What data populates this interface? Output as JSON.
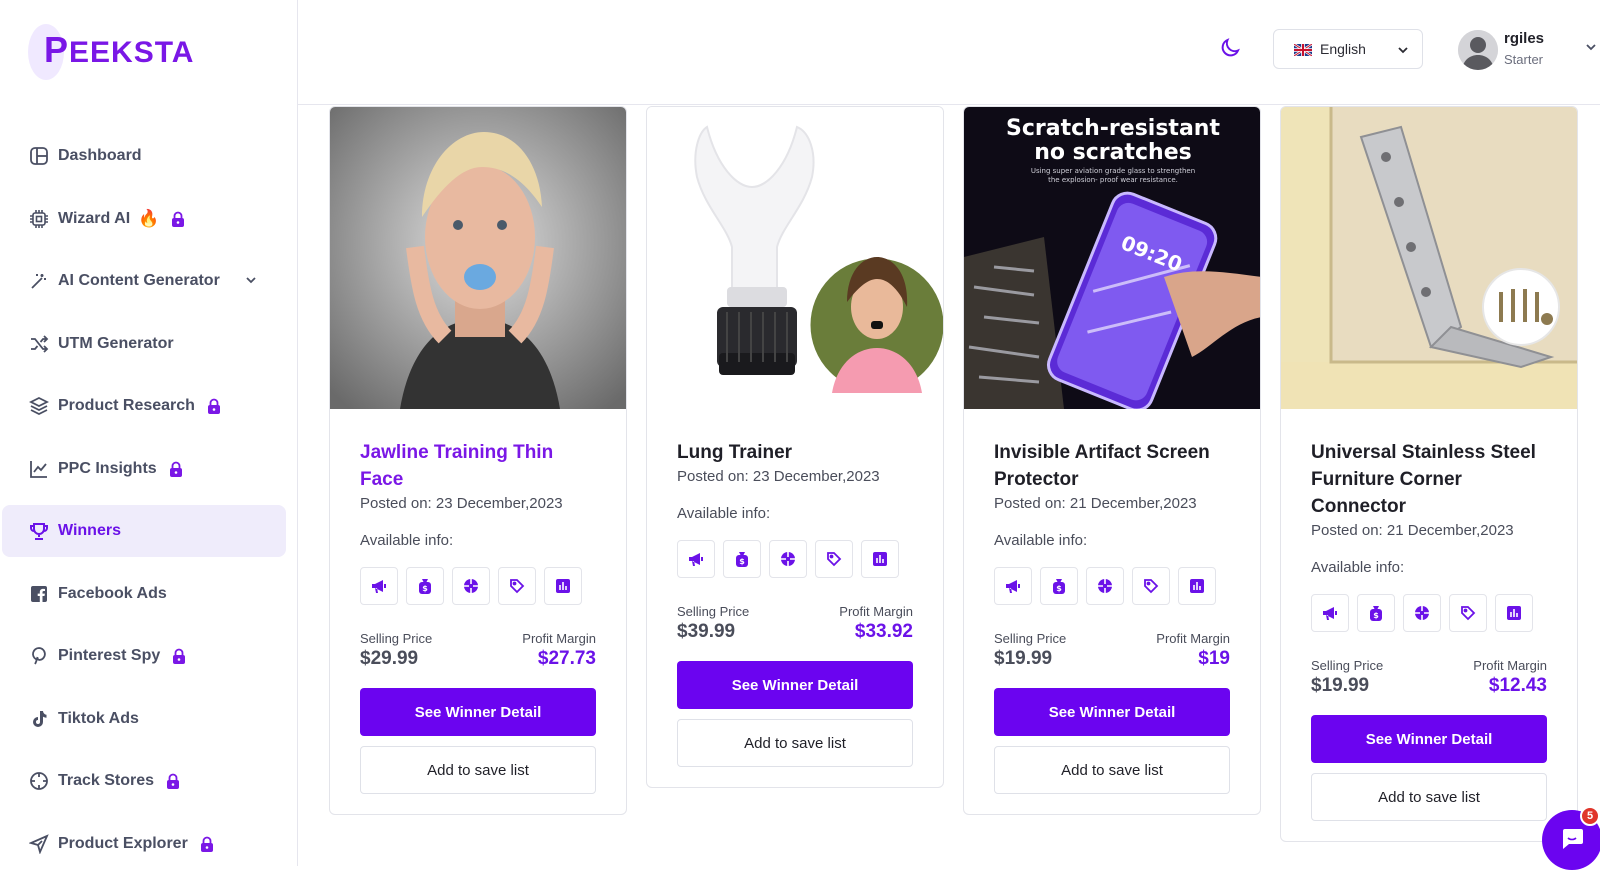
{
  "brand": {
    "logo_first": "P",
    "logo_rest": "EEKSTA"
  },
  "sidebar": {
    "items": [
      {
        "label": "Dashboard",
        "icon": "dashboard-icon",
        "locked": false
      },
      {
        "label": "Wizard AI",
        "icon": "chip-icon",
        "locked": true,
        "emoji": "🔥"
      },
      {
        "label": "AI Content Generator",
        "icon": "magic-wand-icon",
        "locked": false,
        "expandable": true
      },
      {
        "label": "UTM Generator",
        "icon": "shuffle-icon",
        "locked": false
      },
      {
        "label": "Product Research",
        "icon": "layers-icon",
        "locked": true
      },
      {
        "label": "PPC Insights",
        "icon": "line-chart-icon",
        "locked": true
      },
      {
        "label": "Winners",
        "icon": "trophy-icon",
        "locked": false,
        "active": true
      },
      {
        "label": "Facebook Ads",
        "icon": "facebook-icon",
        "locked": false
      },
      {
        "label": "Pinterest Spy",
        "icon": "pinterest-icon",
        "locked": true
      },
      {
        "label": "Tiktok Ads",
        "icon": "tiktok-icon",
        "locked": false
      },
      {
        "label": "Track Stores",
        "icon": "crosshair-icon",
        "locked": true
      },
      {
        "label": "Product Explorer",
        "icon": "send-icon",
        "locked": true
      }
    ]
  },
  "header": {
    "language": "English",
    "user": {
      "name": "rgiles",
      "plan": "Starter"
    }
  },
  "cards": [
    {
      "title": "Jawline Training Thin Face",
      "posted": "Posted on: 23 December,2023",
      "available_label": "Available info:",
      "selling_label": "Selling Price",
      "selling": "$29.99",
      "profit_label": "Profit Margin",
      "profit": "$27.73",
      "detail_label": "See Winner Detail",
      "save_label": "Add to save list"
    },
    {
      "title": "Lung Trainer",
      "posted": "Posted on: 23 December,2023",
      "available_label": "Available info:",
      "selling_label": "Selling Price",
      "selling": "$39.99",
      "profit_label": "Profit Margin",
      "profit": "$33.92",
      "detail_label": "See Winner Detail",
      "save_label": "Add to save list"
    },
    {
      "title": "Invisible Artifact Screen Protector",
      "posted": "Posted on: 21 December,2023",
      "available_label": "Available info:",
      "selling_label": "Selling Price",
      "selling": "$19.99",
      "profit_label": "Profit Margin",
      "profit": "$19",
      "detail_label": "See Winner Detail",
      "save_label": "Add to save list",
      "image_text": {
        "headline_1": "Scratch-resistant",
        "headline_2": "no scratches",
        "sub_1": "Using super aviation grade glass to strengthen",
        "sub_2": "the explosion- proof wear resistance.",
        "phone_time": "09:20"
      }
    },
    {
      "title": "Universal Stainless Steel Furniture Corner Connector",
      "posted": "Posted on: 21 December,2023",
      "available_label": "Available info:",
      "selling_label": "Selling Price",
      "selling": "$19.99",
      "profit_label": "Profit Margin",
      "profit": "$12.43",
      "detail_label": "See Winner Detail",
      "save_label": "Add to save list"
    }
  ],
  "info_icons": [
    "megaphone-icon",
    "money-bag-icon",
    "target-icon",
    "tag-icon",
    "bar-chart-icon"
  ],
  "chat": {
    "badge": "5"
  },
  "colors": {
    "brand": "#6b04f0",
    "accent_text": "#7a17e6",
    "active_bg": "#efecfb"
  }
}
